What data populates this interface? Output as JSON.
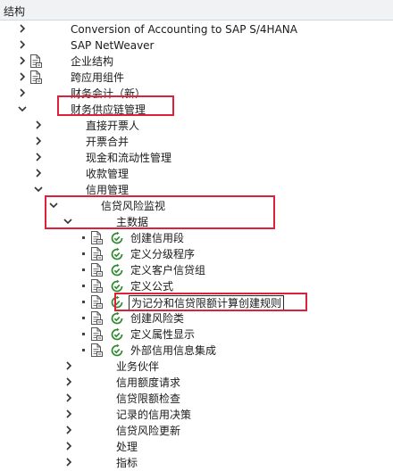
{
  "header": {
    "title": "结构"
  },
  "tree": {
    "items": [
      {
        "label": "Conversion of Accounting to SAP S/4HANA",
        "expand": "collapsed",
        "doc": false,
        "exec": false
      },
      {
        "label": "SAP NetWeaver",
        "expand": "collapsed",
        "doc": false,
        "exec": false
      },
      {
        "label": "企业结构",
        "expand": "collapsed",
        "doc": true,
        "exec": false
      },
      {
        "label": "跨应用组件",
        "expand": "collapsed",
        "doc": true,
        "exec": false
      },
      {
        "label": "财务会计（新）",
        "expand": "collapsed",
        "doc": false,
        "exec": false
      },
      {
        "label": "财务供应链管理",
        "expand": "expanded",
        "doc": false,
        "exec": false
      },
      {
        "label": "直接开票人",
        "expand": "collapsed",
        "doc": false,
        "exec": false
      },
      {
        "label": "开票合并",
        "expand": "collapsed",
        "doc": false,
        "exec": false
      },
      {
        "label": "现金和流动性管理",
        "expand": "collapsed",
        "doc": false,
        "exec": false
      },
      {
        "label": "收款管理",
        "expand": "collapsed",
        "doc": false,
        "exec": false
      },
      {
        "label": "信用管理",
        "expand": "expanded",
        "doc": false,
        "exec": false
      },
      {
        "label": "信贷风险监视",
        "expand": "expanded",
        "doc": false,
        "exec": false
      },
      {
        "label": "主数据",
        "expand": "expanded",
        "doc": false,
        "exec": false
      },
      {
        "label": "创建信用段",
        "expand": "leaf",
        "doc": true,
        "exec": true
      },
      {
        "label": "定义分级程序",
        "expand": "leaf",
        "doc": true,
        "exec": true
      },
      {
        "label": "定义客户信贷组",
        "expand": "leaf",
        "doc": true,
        "exec": true
      },
      {
        "label": "定义公式",
        "expand": "leaf",
        "doc": true,
        "exec": true
      },
      {
        "label": "为记分和信贷限额计算创建规则",
        "expand": "leaf",
        "doc": true,
        "exec": true
      },
      {
        "label": "创建风险类",
        "expand": "leaf",
        "doc": true,
        "exec": true
      },
      {
        "label": "定义属性显示",
        "expand": "leaf",
        "doc": true,
        "exec": true
      },
      {
        "label": "外部信用信息集成",
        "expand": "leaf",
        "doc": true,
        "exec": true
      },
      {
        "label": "业务伙伴",
        "expand": "collapsed",
        "doc": false,
        "exec": false
      },
      {
        "label": "信用额度请求",
        "expand": "collapsed",
        "doc": false,
        "exec": false
      },
      {
        "label": "信贷限额检查",
        "expand": "collapsed",
        "doc": false,
        "exec": false
      },
      {
        "label": "记录的信用决策",
        "expand": "collapsed",
        "doc": false,
        "exec": false
      },
      {
        "label": "信贷风险更新",
        "expand": "collapsed",
        "doc": false,
        "exec": false
      },
      {
        "label": "处理",
        "expand": "collapsed",
        "doc": false,
        "exec": false
      },
      {
        "label": "指标",
        "expand": "collapsed",
        "doc": false,
        "exec": false
      }
    ]
  },
  "colors": {
    "highlight": "#e0203a",
    "exec_icon": "#2f8a2f",
    "header_bg": "#f0f2f4"
  }
}
